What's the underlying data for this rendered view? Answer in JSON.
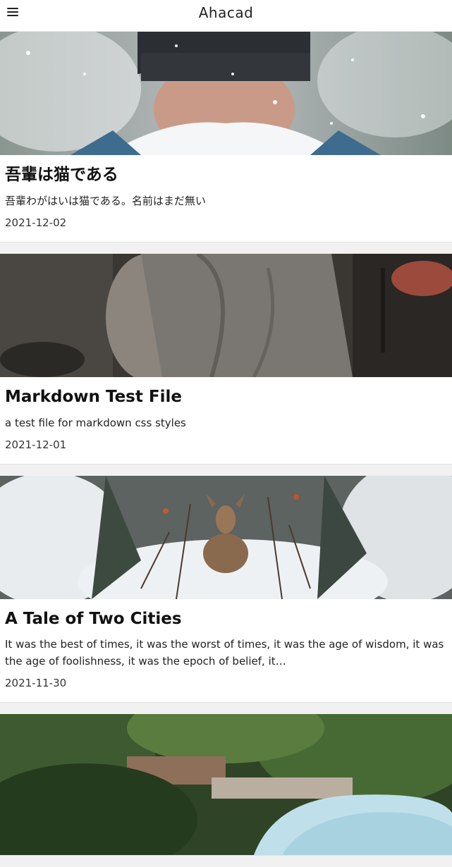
{
  "header": {
    "title": "Ahacad",
    "menu_icon": "hamburger-icon"
  },
  "posts": [
    {
      "title": "吾輩は猫である",
      "excerpt": "吾輩わがはいは猫である。名前はまだ無い",
      "date": "2021-12-02",
      "image": "snow-face-photo"
    },
    {
      "title": "Markdown Test File",
      "excerpt": "a test file for markdown css styles",
      "date": "2021-12-01",
      "image": "grey-sweater-photo"
    },
    {
      "title": "A Tale of Two Cities",
      "excerpt": "It was the best of times, it was the worst of times, it was the age of wisdom, it was the age of foolishness, it was the epoch of belief, it…",
      "date": "2021-11-30",
      "image": "deer-in-snow-photo"
    },
    {
      "image": "garden-car-photo"
    }
  ]
}
